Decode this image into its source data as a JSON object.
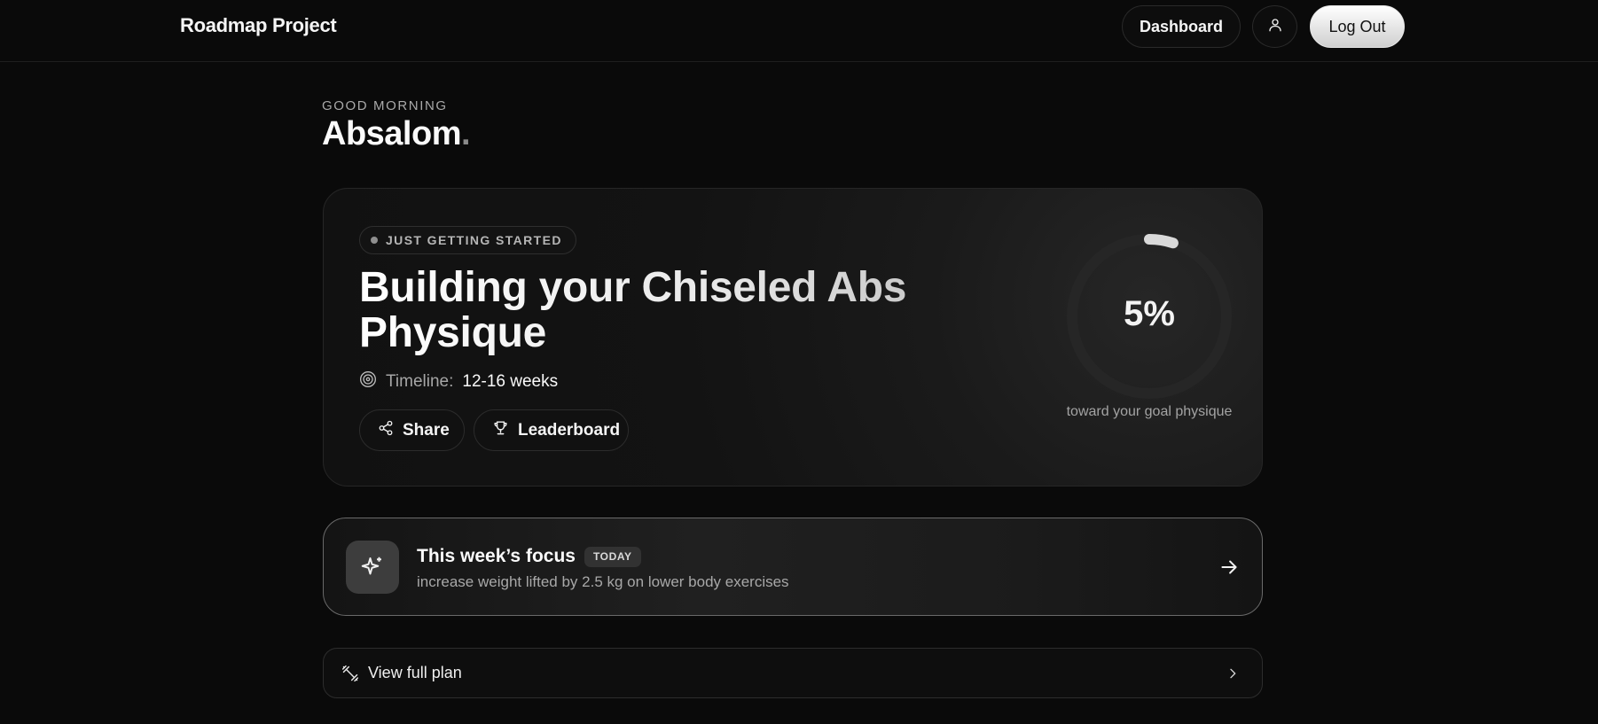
{
  "nav": {
    "brand": "Roadmap Project",
    "dashboard_label": "Dashboard",
    "profile_icon": "user-icon",
    "logout_label": "Log Out"
  },
  "greeting": {
    "kicker": "GOOD MORNING",
    "name": "Absalom",
    "punctuation": "."
  },
  "hero": {
    "status_pill": "JUST GETTING STARTED",
    "title": "Building your Chiseled Abs Physique",
    "timeline_label": "Timeline:",
    "timeline_value": "12-16 weeks",
    "timeline_icon": "target-icon",
    "share_label": "Share",
    "share_icon": "share-icon",
    "leaderboard_label": "Leaderboard",
    "leaderboard_icon": "trophy-icon",
    "progress_percent": 5,
    "progress_text": "5%",
    "progress_caption": "toward your goal physique"
  },
  "focus": {
    "icon": "sparkles-icon",
    "title": "This week’s focus",
    "badge": "TODAY",
    "description": "increase weight lifted by 2.5 kg on lower body exercises",
    "arrow_icon": "arrow-right-icon"
  },
  "plan": {
    "icon": "dumbbell-icon",
    "label": "View full plan",
    "chevron_icon": "chevron-right-icon"
  },
  "colors": {
    "background": "#0a0a0a",
    "card": "#131313",
    "accent_text": "#fafafa",
    "muted_text": "#a6a6a6",
    "ring_track": "#262626",
    "ring_progress": "#d9d9d9"
  }
}
